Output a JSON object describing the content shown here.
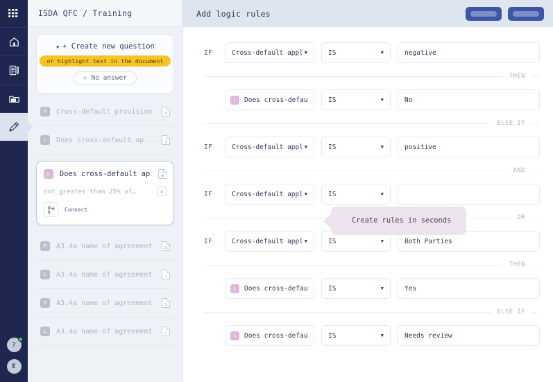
{
  "rail": {
    "items": [
      {
        "name": "apps-grid-icon",
        "label": "Apps"
      },
      {
        "name": "home-icon",
        "label": "Home"
      },
      {
        "name": "document-edit-icon",
        "label": "Documents"
      },
      {
        "name": "folder-icon",
        "label": "Folders"
      },
      {
        "name": "highlighter-icon",
        "label": "Highlighter",
        "active": true
      }
    ],
    "help_avatar": "?",
    "user_avatar": "E"
  },
  "sidebar": {
    "title": "ISDA QFC / Training",
    "create_card": {
      "star_icon": "star-icon",
      "create_label": "+ Create new question",
      "highlight_hint": "or highlight text in the document",
      "no_answer_label": "No answer",
      "no_answer_icon": "close-icon"
    },
    "items": [
      {
        "badge": "P",
        "badge_kind": "grey",
        "label": "Cross-default provision",
        "doc_count": "25"
      },
      {
        "badge": "L",
        "badge_kind": "grey",
        "label": "Does cross-default ap...",
        "doc_count": "3"
      }
    ],
    "selected_card": {
      "badge": "L",
      "title": "Does cross-default ap...",
      "doc_count": "48",
      "subtitle": "not greater than 25% of…",
      "close_icon": "close-icon",
      "connect_icon": "connect-branch-icon",
      "connect_label": "Connect"
    },
    "items_bottom": [
      {
        "badge": "P",
        "badge_kind": "grey",
        "label": "A3.4a name of agreement",
        "doc_count": "25"
      },
      {
        "badge": "L",
        "badge_kind": "grey",
        "label": "A3.4a name of agreement",
        "doc_count": "3"
      },
      {
        "badge": "P",
        "badge_kind": "grey",
        "label": "A3.4a name of agreement",
        "doc_count": "25"
      },
      {
        "badge": "L",
        "badge_kind": "grey",
        "label": "A3.4a name of agreement",
        "doc_count": "3"
      }
    ]
  },
  "main": {
    "title": "Add logic rules",
    "header_buttons": [
      {
        "name": "secondary-action-button",
        "label": ""
      },
      {
        "name": "primary-action-button",
        "label": ""
      }
    ],
    "tooltip": "Create rules in seconds",
    "rows": [
      {
        "kind": "if",
        "if_label": "IF",
        "badge": null,
        "question": "Cross-default appl",
        "operator": "IS",
        "value": "negative"
      },
      {
        "kind": "conj",
        "text": "THEN"
      },
      {
        "kind": "then",
        "if_label": "",
        "badge": "L",
        "question": "Does cross-default...",
        "operator": "IS",
        "value": "No"
      },
      {
        "kind": "conj",
        "text": "ELSE IF"
      },
      {
        "kind": "if",
        "if_label": "IF",
        "badge": null,
        "question": "Cross-default appl",
        "operator": "IS",
        "value": "positive"
      },
      {
        "kind": "conj",
        "text": "AND"
      },
      {
        "kind": "if",
        "if_label": "IF",
        "badge": null,
        "question": "Cross-default appl",
        "operator": "IS",
        "value": ""
      },
      {
        "kind": "conj",
        "text": "OR"
      },
      {
        "kind": "if",
        "if_label": "IF",
        "badge": null,
        "question": "Cross-default appl",
        "operator": "IS",
        "value": "Both Parties"
      },
      {
        "kind": "conj",
        "text": "THEN"
      },
      {
        "kind": "then",
        "if_label": "",
        "badge": "L",
        "question": "Does cross-default...",
        "operator": "IS",
        "value": "Yes"
      },
      {
        "kind": "conj",
        "text": "ELSE IF"
      },
      {
        "kind": "then",
        "if_label": "",
        "badge": "L",
        "question": "Does cross-default...",
        "operator": "IS",
        "value": "Needs review"
      }
    ]
  },
  "colors": {
    "rail_bg": "#1f2751",
    "sidebar_bg": "#eef2f7",
    "main_header_bg": "#dde5ee",
    "accent_blue": "#3f55a5",
    "highlight_yellow": "#f7c325",
    "badge_lavender": "#ddb8dd",
    "tooltip_bg": "#ece3ee",
    "status_green": "#3ccf4e"
  }
}
